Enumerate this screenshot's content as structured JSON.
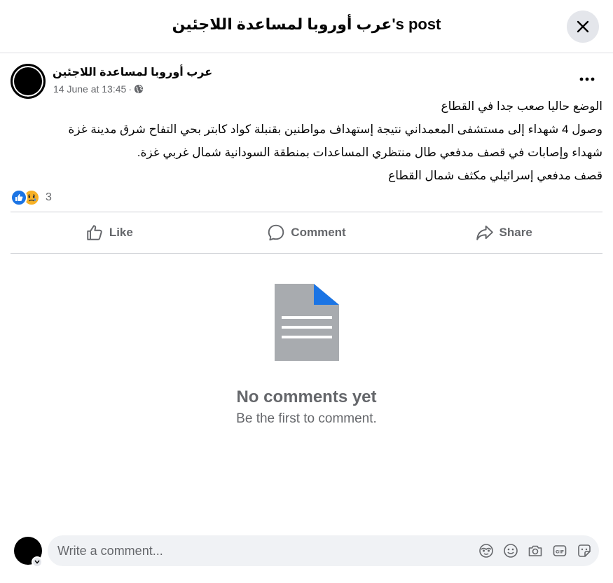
{
  "header": {
    "title": "عرب أوروبا لمساعدة اللاجئين's post"
  },
  "post": {
    "page_name": "عرب أوروبا لمساعدة اللاجئين",
    "date": "14 June at 13:45",
    "separator": "·",
    "body_lines": [
      "الوضع حاليا صعب جدا في القطاع",
      "وصول 4 شهداء إلى مستشفى المعمداني نتيجة إستهداف مواطنين بقنبلة كواد كابتر بحي التفاح شرق مدينة غزة",
      "شهداء وإصابات في قصف مدفعي طال منتظري المساعدات بمنطقة السودانية شمال غربي غزة.",
      "قصف مدفعي إسرائيلي مكثف شمال القطاع"
    ],
    "reaction_count": "3"
  },
  "actions": {
    "like": "Like",
    "comment": "Comment",
    "share": "Share"
  },
  "empty_state": {
    "title": "No comments yet",
    "subtitle": "Be the first to comment."
  },
  "composer": {
    "placeholder": "Write a comment..."
  },
  "colors": {
    "accent": "#1b74e4",
    "muted": "#65676b",
    "divider": "#ced0d4",
    "input_bg": "#f0f2f5"
  }
}
